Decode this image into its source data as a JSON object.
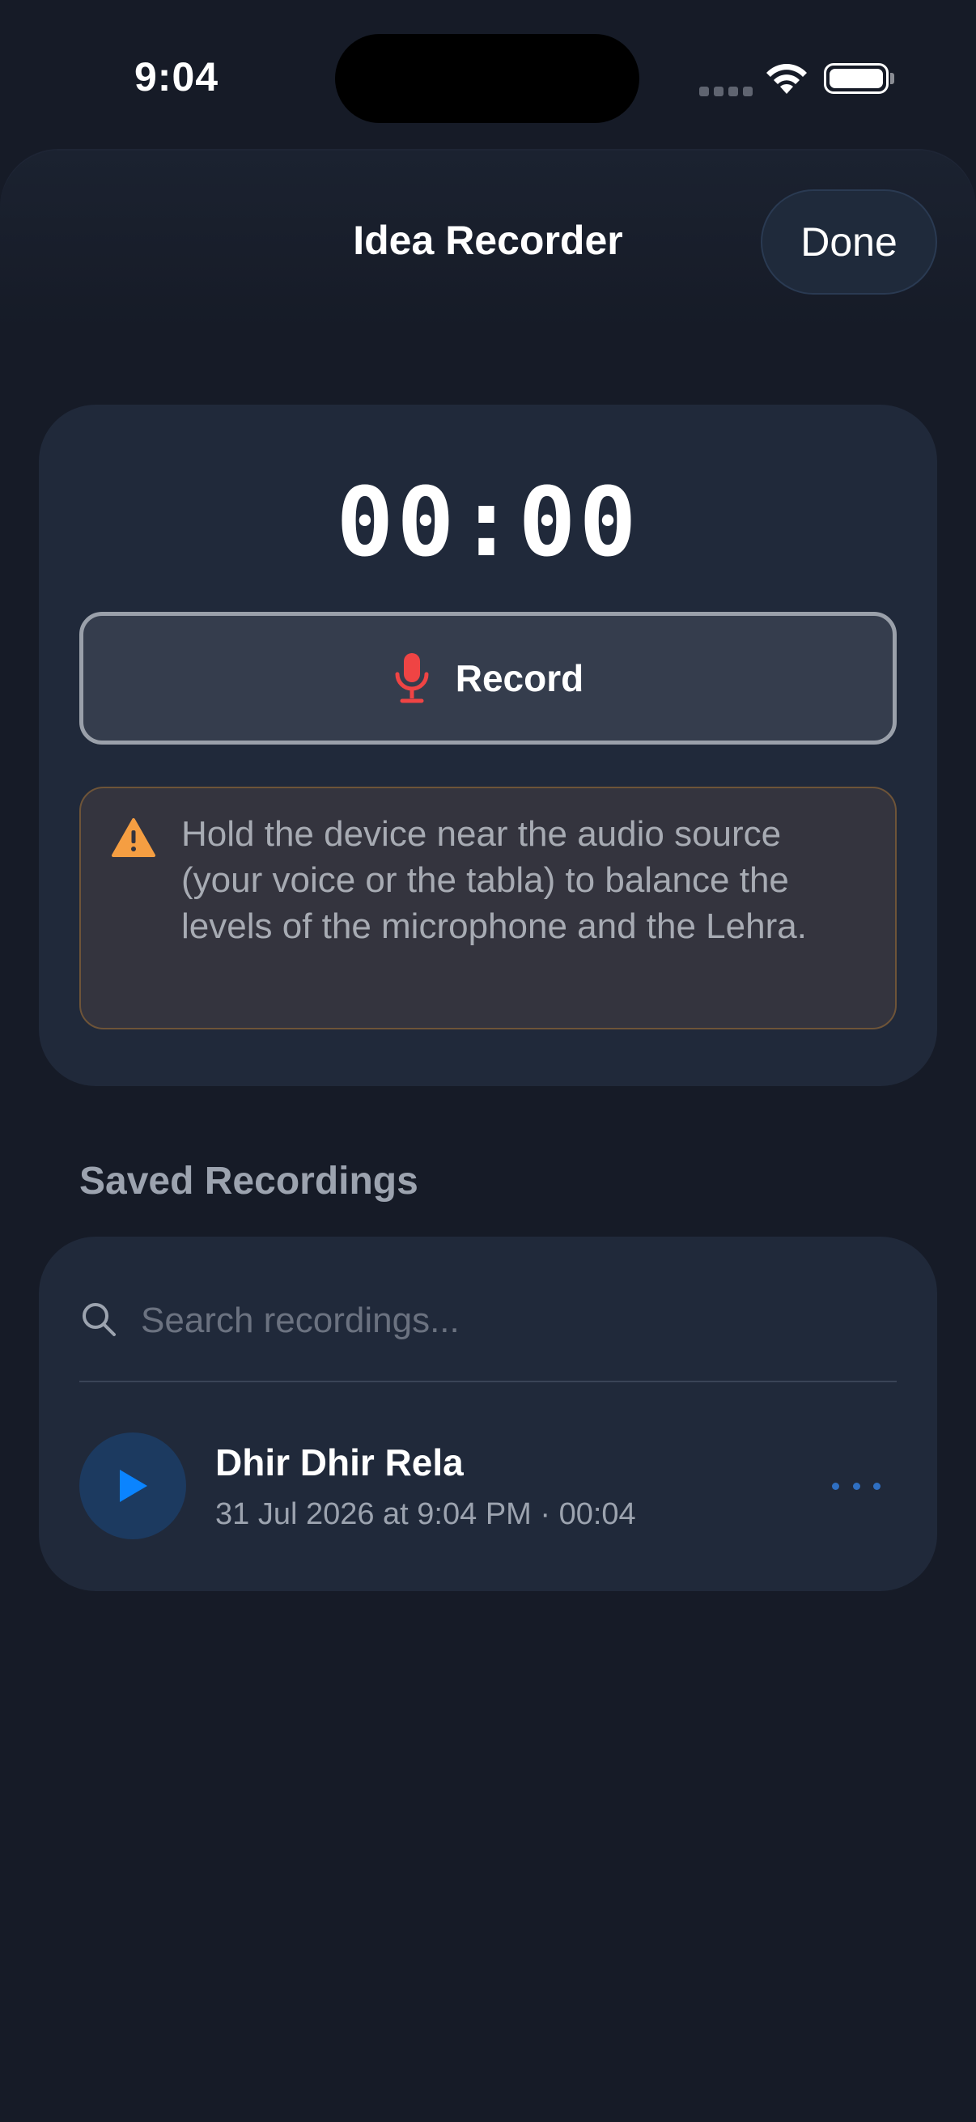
{
  "status_bar": {
    "time": "9:04"
  },
  "nav": {
    "title": "Idea Recorder",
    "done_label": "Done"
  },
  "recorder": {
    "timer": "00:00",
    "record_label": "Record",
    "record_icon": "microphone-icon",
    "warning_icon": "warning-triangle-icon",
    "warning_text": "Hold the device near the audio source (your voice or the tabla) to balance the levels of the microphone and the Lehra."
  },
  "saved": {
    "section_title": "Saved Recordings",
    "search_placeholder": "Search recordings...",
    "search_value": "",
    "recordings": [
      {
        "title": "Dhir Dhir Rela",
        "meta": "31 Jul 2026 at 9:04 PM · 00:04"
      }
    ]
  },
  "colors": {
    "background": "#161b27",
    "card": "#20293a",
    "accent_blue": "#0a84ff",
    "record_red": "#ef4444",
    "warning_orange": "#f59e42"
  }
}
